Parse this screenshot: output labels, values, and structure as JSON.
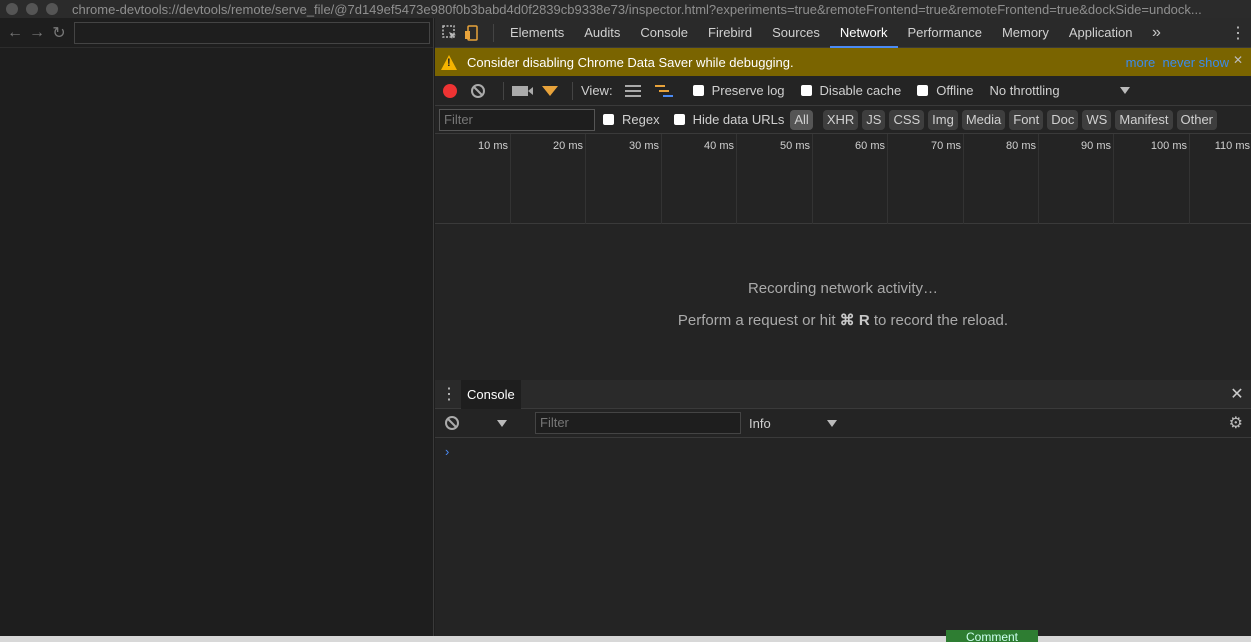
{
  "window": {
    "url": "chrome-devtools://devtools/remote/serve_file/@7d149ef5473e980f0b3babd4d0f2839cb9338e73/inspector.html?experiments=true&remoteFrontend=true&remoteFrontend=true&dockSide=undock..."
  },
  "browser": {
    "address_value": ""
  },
  "devtools": {
    "tabs": [
      "Elements",
      "Audits",
      "Console",
      "Firebird",
      "Sources",
      "Network",
      "Performance",
      "Memory",
      "Application"
    ],
    "active_tab": "Network",
    "more_tabs_label": "»"
  },
  "warning": {
    "text": "Consider disabling Chrome Data Saver while debugging.",
    "more_link": "more",
    "never_show_link": "never show"
  },
  "network_toolbar": {
    "view_label": "View:",
    "preserve_log": "Preserve log",
    "disable_cache": "Disable cache",
    "offline": "Offline",
    "throttling": "No throttling"
  },
  "filter_bar": {
    "placeholder": "Filter",
    "regex": "Regex",
    "hide_data_urls": "Hide data URLs",
    "types": [
      "All",
      "XHR",
      "JS",
      "CSS",
      "Img",
      "Media",
      "Font",
      "Doc",
      "WS",
      "Manifest",
      "Other"
    ]
  },
  "timeline": {
    "ticks": [
      "10 ms",
      "20 ms",
      "30 ms",
      "40 ms",
      "50 ms",
      "60 ms",
      "70 ms",
      "80 ms",
      "90 ms",
      "100 ms",
      "110 ms"
    ]
  },
  "empty_state": {
    "line1": "Recording network activity…",
    "line2_prefix": "Perform a request or hit ",
    "line2_key": "⌘ R",
    "line2_suffix": " to record the reload."
  },
  "drawer": {
    "tab": "Console",
    "filter_placeholder": "Filter",
    "level": "Info",
    "prompt": "›"
  },
  "page_bottom": {
    "button": "Comment"
  }
}
